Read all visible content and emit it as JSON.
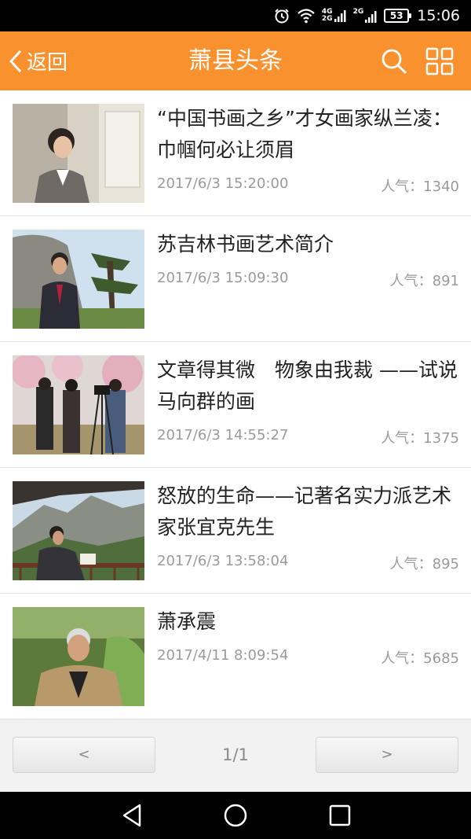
{
  "status_bar": {
    "network_top": "4G",
    "network_bottom": "2G",
    "network2": "2G",
    "battery": "53",
    "time": "15:06",
    "icons": [
      "alarm-icon",
      "wifi-icon",
      "signal-icon",
      "battery-icon"
    ]
  },
  "header": {
    "back_label": "返回",
    "title": "萧县头条",
    "icons": [
      "chevron-left-icon",
      "search-icon",
      "grid-icon"
    ],
    "color": "#f9912f"
  },
  "news": [
    {
      "title": "“中国书画之乡”才女画家纵兰凌：巾帼何必让须眉",
      "date": "2017/6/3 15:20:00",
      "popularity": "人气：1340"
    },
    {
      "title": "苏吉林书画艺术简介",
      "date": "2017/6/3 15:09:30",
      "popularity": "人气：891"
    },
    {
      "title": "文章得其微　物象由我裁 ——试说马向群的画",
      "date": "2017/6/3 14:55:27",
      "popularity": "人气：1375"
    },
    {
      "title": "怒放的生命——记著名实力派艺术家张宜克先生",
      "date": "2017/6/3 13:58:04",
      "popularity": "人气：895"
    },
    {
      "title": "萧承震",
      "date": "2017/4/11 8:09:54",
      "popularity": "人气：5685"
    }
  ],
  "pager": {
    "prev_label": "<",
    "next_label": ">",
    "indicator": "1/1"
  },
  "nav_bar": {
    "icons": [
      "back-triangle-icon",
      "home-circle-icon",
      "recent-square-icon"
    ]
  }
}
